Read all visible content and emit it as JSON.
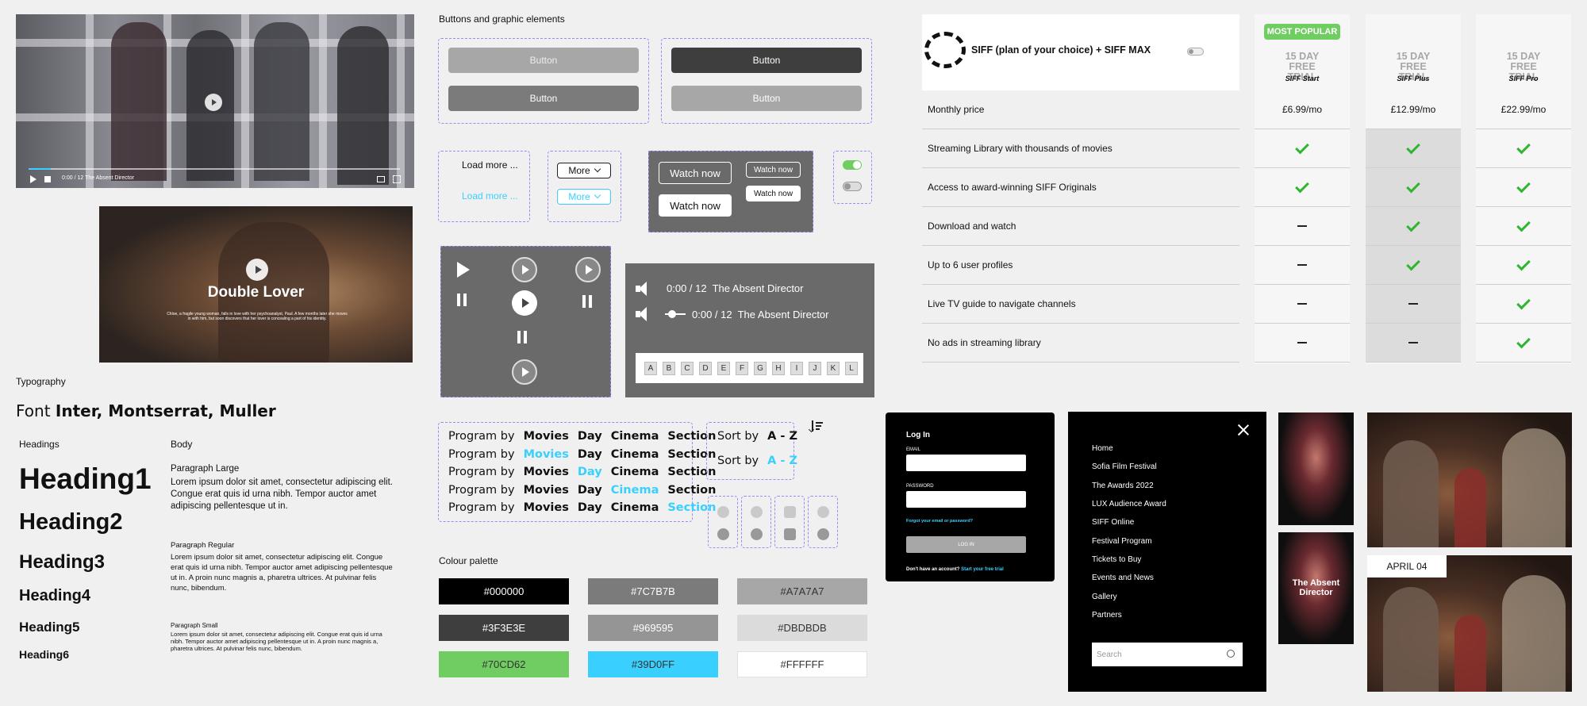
{
  "video1": {
    "time": "0:00 / 12 The Absent Director"
  },
  "film": {
    "title": "Double Lover",
    "desc": "Chloe, a fragile young woman, falls in love with her psychoanalyst, Paul. A few months later she moves in with him, but soon discovers that her lover is concealing a part of his identity."
  },
  "typography": {
    "section": "Typography",
    "font_prefix": "Font",
    "font_names": "Inter, Montserrat, Muller",
    "headings_label": "Headings",
    "body_label": "Body",
    "h1": "Heading1",
    "h2": "Heading2",
    "h3": "Heading3",
    "h4": "Heading4",
    "h5": "Heading5",
    "h6": "Heading6",
    "p_large_label": "Paragraph Large",
    "p_large": "Lorem ipsum dolor sit amet, consectetur adipiscing elit. Congue erat quis id urna nibh. Tempor auctor amet adipiscing pellentesque ut in.",
    "p_regular_label": "Paragraph Regular",
    "p_regular": "Lorem ipsum dolor sit amet, consectetur adipiscing elit. Congue erat quis id urna nibh. Tempor auctor amet adipiscing pellentesque ut in. A proin nunc magnis a, pharetra ultrices. At pulvinar felis nunc, bibendum.",
    "p_small_label": "Paragraph Small",
    "p_small": "Lorem ipsum dolor sit amet, consectetur adipiscing elit. Congue erat quis id urna nibh. Tempor auctor amet adipiscing pellentesque ut in. A proin nunc magnis a, pharetra ultrices. At pulvinar felis nunc, bibendum."
  },
  "buttons": {
    "section": "Buttons and graphic elements",
    "button": "Button",
    "load_more": "Load more ...",
    "more": "More",
    "watch_now": "Watch now"
  },
  "audio": {
    "time": "0:00 / 12",
    "title": "The Absent Director",
    "letters": [
      "A",
      "B",
      "C",
      "D",
      "E",
      "F",
      "G",
      "H",
      "I",
      "J",
      "K",
      "L"
    ]
  },
  "program": {
    "prefix": "Program by",
    "options": [
      "Movies",
      "Day",
      "Cinema",
      "Section"
    ],
    "sort_prefix": "Sort by",
    "sort_value": "A - Z"
  },
  "palette": {
    "section": "Colour palette",
    "colors": [
      "#000000",
      "#7C7B7B",
      "#A7A7A7",
      "#3F3E3E",
      "#969595",
      "#DBDBDB",
      "#70CD62",
      "#39D0FF",
      "#FFFFFF"
    ]
  },
  "pricing": {
    "title": "SIFF (plan of your choice) + SIFF MAX",
    "badge": "MOST POPULAR",
    "trial": "15 DAY FREE TRIAL",
    "plans": [
      {
        "name": "SIFF Start",
        "price": "£6.99/mo"
      },
      {
        "name": "SIFF Plus",
        "price": "£12.99/mo"
      },
      {
        "name": "SIFF Pro",
        "price": "£22.99/mo"
      }
    ],
    "rows": [
      {
        "label": "Monthly price"
      },
      {
        "label": "Streaming Library with thousands of movies",
        "vals": [
          "check",
          "check",
          "check"
        ]
      },
      {
        "label": "Access to award-winning SIFF Originals",
        "vals": [
          "check",
          "check",
          "check"
        ]
      },
      {
        "label": "Download and watch",
        "vals": [
          "dash",
          "check",
          "check"
        ]
      },
      {
        "label": "Up to 6 user profiles",
        "vals": [
          "dash",
          "check",
          "check"
        ]
      },
      {
        "label": "Live TV guide to navigate channels",
        "vals": [
          "dash",
          "dash",
          "check"
        ]
      },
      {
        "label": "No ads in streaming library",
        "vals": [
          "dash",
          "dash",
          "check"
        ]
      }
    ]
  },
  "login": {
    "title": "Log In",
    "email": "EMAIL",
    "password": "PASSWORD",
    "forgot": "Forgot your email or password?",
    "button": "LOG IN",
    "no_account": "Don't have an account?",
    "trial": "Start your free trial"
  },
  "menu": {
    "items": [
      "Home",
      "Sofia Film Festival",
      "The Awards 2022",
      "LUX Audience Award",
      "SIFF Online",
      "Festival Program",
      "Tickets to Buy",
      "Events and News",
      "Gallery",
      "Partners"
    ],
    "search": "Search"
  },
  "poster": {
    "title": "The Absent Director"
  },
  "date_card": {
    "date": "APRIL 04"
  }
}
